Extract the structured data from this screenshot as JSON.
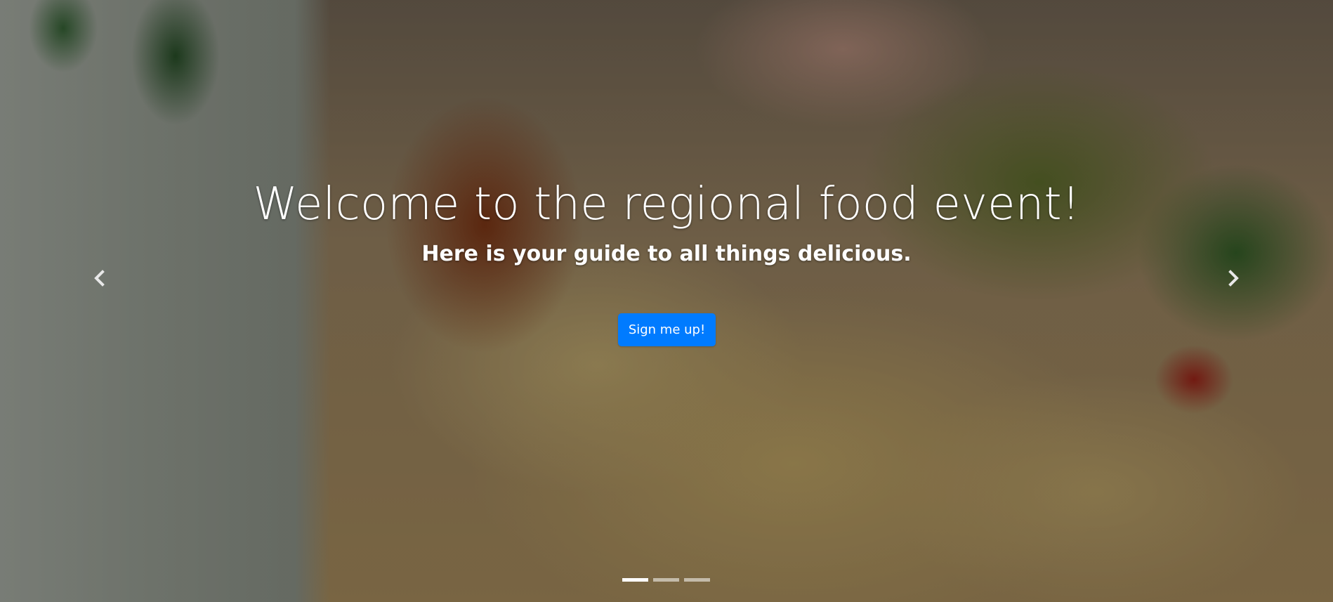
{
  "hero": {
    "title": "Welcome to the regional food event!",
    "subtitle": "Here is your guide to all things delicious.",
    "cta_label": "Sign me up!"
  },
  "carousel": {
    "slide_count": 3,
    "active_index": 0,
    "prev_icon": "chevron-left-icon",
    "next_icon": "chevron-right-icon"
  },
  "colors": {
    "primary": "#007bff",
    "text": "#ffffff"
  }
}
